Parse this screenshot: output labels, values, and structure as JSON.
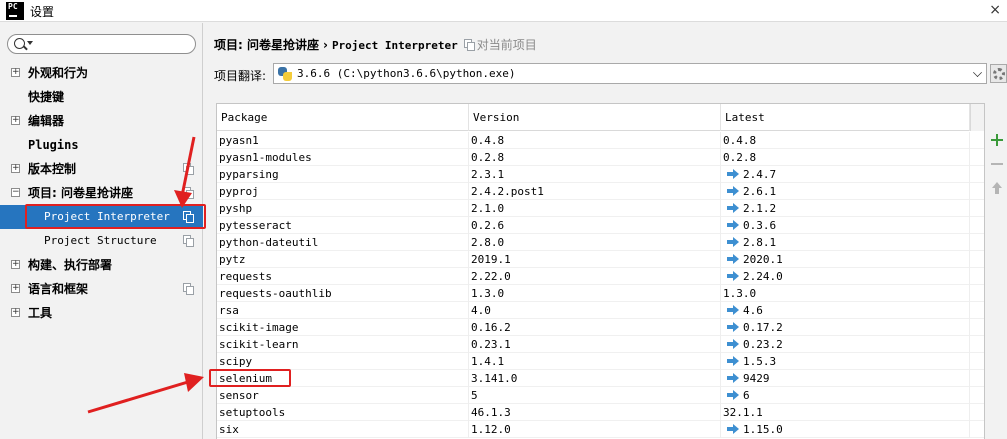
{
  "window": {
    "app_icon_text": "PC",
    "title": "设置",
    "close_glyph": "×"
  },
  "sidebar": {
    "search_placeholder": "",
    "items": [
      {
        "label": "外观和行为",
        "expandable": true
      },
      {
        "label": "快捷键",
        "expandable": false
      },
      {
        "label": "编辑器",
        "expandable": true
      },
      {
        "label": "Plugins",
        "expandable": false
      },
      {
        "label": "版本控制",
        "expandable": true,
        "copy_icon": true
      },
      {
        "label": "项目: 问卷星抢讲座",
        "expandable": true,
        "expanded": true,
        "copy_icon": true
      },
      {
        "label": "构建、执行部署",
        "expandable": true
      },
      {
        "label": "语言和框架",
        "expandable": true,
        "copy_icon": true
      },
      {
        "label": "工具",
        "expandable": true
      }
    ],
    "sub_items": [
      {
        "label": "Project Interpreter",
        "selected": true
      },
      {
        "label": "Project Structure",
        "selected": false
      }
    ],
    "toggle_plus": "+",
    "toggle_minus": "−"
  },
  "main": {
    "breadcrumb": {
      "project": "项目: 问卷星抢讲座",
      "separator": "›",
      "page": "Project Interpreter",
      "scope": "对当前项目"
    },
    "interpreter": {
      "label": "项目翻译:",
      "value": "3.6.6 (C:\\python3.6.6\\python.exe)"
    },
    "table": {
      "columns": [
        "Package",
        "Version",
        "Latest"
      ],
      "rows": [
        {
          "package": "pyasn1",
          "version": "0.4.8",
          "latest": "0.4.8",
          "upgrade": false
        },
        {
          "package": "pyasn1-modules",
          "version": "0.2.8",
          "latest": "0.2.8",
          "upgrade": false
        },
        {
          "package": "pyparsing",
          "version": "2.3.1",
          "latest": "2.4.7",
          "upgrade": true
        },
        {
          "package": "pyproj",
          "version": "2.4.2.post1",
          "latest": "2.6.1",
          "upgrade": true
        },
        {
          "package": "pyshp",
          "version": "2.1.0",
          "latest": "2.1.2",
          "upgrade": true
        },
        {
          "package": "pytesseract",
          "version": "0.2.6",
          "latest": "0.3.6",
          "upgrade": true
        },
        {
          "package": "python-dateutil",
          "version": "2.8.0",
          "latest": "2.8.1",
          "upgrade": true
        },
        {
          "package": "pytz",
          "version": "2019.1",
          "latest": "2020.1",
          "upgrade": true
        },
        {
          "package": "requests",
          "version": "2.22.0",
          "latest": "2.24.0",
          "upgrade": true
        },
        {
          "package": "requests-oauthlib",
          "version": "1.3.0",
          "latest": "1.3.0",
          "upgrade": false
        },
        {
          "package": "rsa",
          "version": "4.0",
          "latest": "4.6",
          "upgrade": true
        },
        {
          "package": "scikit-image",
          "version": "0.16.2",
          "latest": "0.17.2",
          "upgrade": true
        },
        {
          "package": "scikit-learn",
          "version": "0.23.1",
          "latest": "0.23.2",
          "upgrade": true
        },
        {
          "package": "scipy",
          "version": "1.4.1",
          "latest": "1.5.3",
          "upgrade": true
        },
        {
          "package": "selenium",
          "version": "3.141.0",
          "latest": "9429",
          "upgrade": true
        },
        {
          "package": "sensor",
          "version": "5",
          "latest": "6",
          "upgrade": true
        },
        {
          "package": "setuptools",
          "version": "46.1.3",
          "latest": "32.1.1",
          "upgrade": false
        },
        {
          "package": "six",
          "version": "1.12.0",
          "latest": "1.15.0",
          "upgrade": true
        }
      ]
    },
    "toolbar": [
      "plus-icon",
      "minus-icon",
      "up-icon"
    ]
  },
  "annotations": {
    "color": "#e02020",
    "highlighted": [
      "Project Interpreter",
      "selenium"
    ]
  },
  "colors": {
    "selection": "#2675bf",
    "upgrade_arrow": "#3d8fd1",
    "add": "#3a9a3a"
  }
}
